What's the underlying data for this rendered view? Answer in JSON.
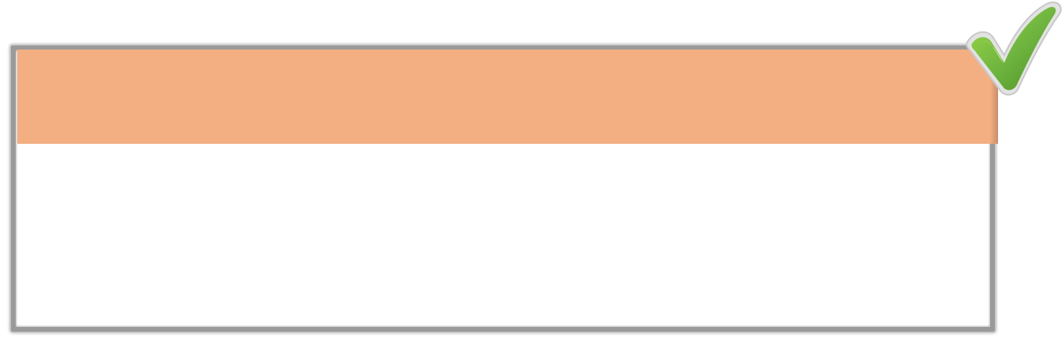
{
  "card": {
    "header_color": "#f3ae82",
    "frame_color": "#9a9a9a",
    "body_color": "#ffffff"
  },
  "badge": {
    "icon": "checkmark-icon",
    "color": "#6db33f",
    "outline_color": "#d9d9d9"
  }
}
